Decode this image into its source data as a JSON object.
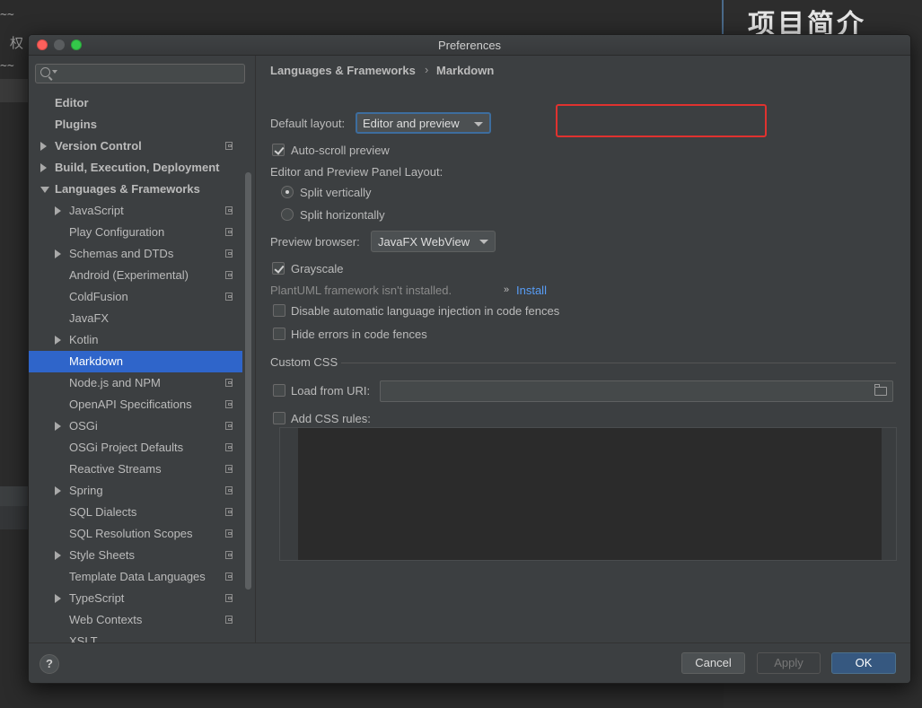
{
  "background": {
    "lines": [
      "~~",
      "权",
      "~~"
    ],
    "heading": "项目简介"
  },
  "dialog": {
    "title": "Preferences",
    "search": {
      "placeholder": ""
    },
    "tree": [
      {
        "label": "Editor",
        "level": 0,
        "arrow": "none",
        "project_icon": false,
        "bold": true
      },
      {
        "label": "Plugins",
        "level": 0,
        "arrow": "none",
        "project_icon": false,
        "bold": true
      },
      {
        "label": "Version Control",
        "level": 0,
        "arrow": "right",
        "project_icon": true,
        "bold": true
      },
      {
        "label": "Build, Execution, Deployment",
        "level": 0,
        "arrow": "right",
        "project_icon": false,
        "bold": true
      },
      {
        "label": "Languages & Frameworks",
        "level": 0,
        "arrow": "down",
        "project_icon": false,
        "bold": true
      },
      {
        "label": "JavaScript",
        "level": 1,
        "arrow": "right",
        "project_icon": true
      },
      {
        "label": "Play Configuration",
        "level": 1,
        "arrow": "none",
        "project_icon": true
      },
      {
        "label": "Schemas and DTDs",
        "level": 1,
        "arrow": "right",
        "project_icon": true
      },
      {
        "label": "Android (Experimental)",
        "level": 1,
        "arrow": "none",
        "project_icon": true
      },
      {
        "label": "ColdFusion",
        "level": 1,
        "arrow": "none",
        "project_icon": true
      },
      {
        "label": "JavaFX",
        "level": 1,
        "arrow": "none",
        "project_icon": false
      },
      {
        "label": "Kotlin",
        "level": 1,
        "arrow": "right",
        "project_icon": false
      },
      {
        "label": "Markdown",
        "level": 1,
        "arrow": "none",
        "project_icon": false,
        "selected": true
      },
      {
        "label": "Node.js and NPM",
        "level": 1,
        "arrow": "none",
        "project_icon": true
      },
      {
        "label": "OpenAPI Specifications",
        "level": 1,
        "arrow": "none",
        "project_icon": true
      },
      {
        "label": "OSGi",
        "level": 1,
        "arrow": "right",
        "project_icon": true
      },
      {
        "label": "OSGi Project Defaults",
        "level": 1,
        "arrow": "none",
        "project_icon": true
      },
      {
        "label": "Reactive Streams",
        "level": 1,
        "arrow": "none",
        "project_icon": true
      },
      {
        "label": "Spring",
        "level": 1,
        "arrow": "right",
        "project_icon": true
      },
      {
        "label": "SQL Dialects",
        "level": 1,
        "arrow": "none",
        "project_icon": true
      },
      {
        "label": "SQL Resolution Scopes",
        "level": 1,
        "arrow": "none",
        "project_icon": true
      },
      {
        "label": "Style Sheets",
        "level": 1,
        "arrow": "right",
        "project_icon": true
      },
      {
        "label": "Template Data Languages",
        "level": 1,
        "arrow": "none",
        "project_icon": true
      },
      {
        "label": "TypeScript",
        "level": 1,
        "arrow": "right",
        "project_icon": true
      },
      {
        "label": "Web Contexts",
        "level": 1,
        "arrow": "none",
        "project_icon": true
      },
      {
        "label": "XSLT",
        "level": 1,
        "arrow": "none",
        "project_icon": false
      }
    ],
    "breadcrumb": {
      "parent": "Languages & Frameworks",
      "separator": "›",
      "current": "Markdown"
    },
    "markdown": {
      "default_layout_label": "Default layout:",
      "default_layout_value": "Editor and preview",
      "auto_scroll_label": "Auto-scroll preview",
      "auto_scroll_checked": true,
      "panel_layout_label": "Editor and Preview Panel Layout:",
      "split_vertically": "Split vertically",
      "split_horizontally": "Split horizontally",
      "split_selected": "vertically",
      "preview_browser_label": "Preview browser:",
      "preview_browser_value": "JavaFX WebView",
      "grayscale_label": "Grayscale",
      "grayscale_checked": true,
      "plantuml_message": "PlantUML framework isn't installed.",
      "install_link_icon": "»",
      "install_link": "Install",
      "disable_injection_label": "Disable automatic language injection in code fences",
      "hide_errors_label": "Hide errors in code fences",
      "custom_css_title": "Custom CSS",
      "load_from_uri_label": "Load from URI:",
      "load_from_uri_value": "",
      "add_css_rules_label": "Add CSS rules:"
    },
    "footer": {
      "help": "?",
      "cancel": "Cancel",
      "apply": "Apply",
      "ok": "OK"
    }
  }
}
